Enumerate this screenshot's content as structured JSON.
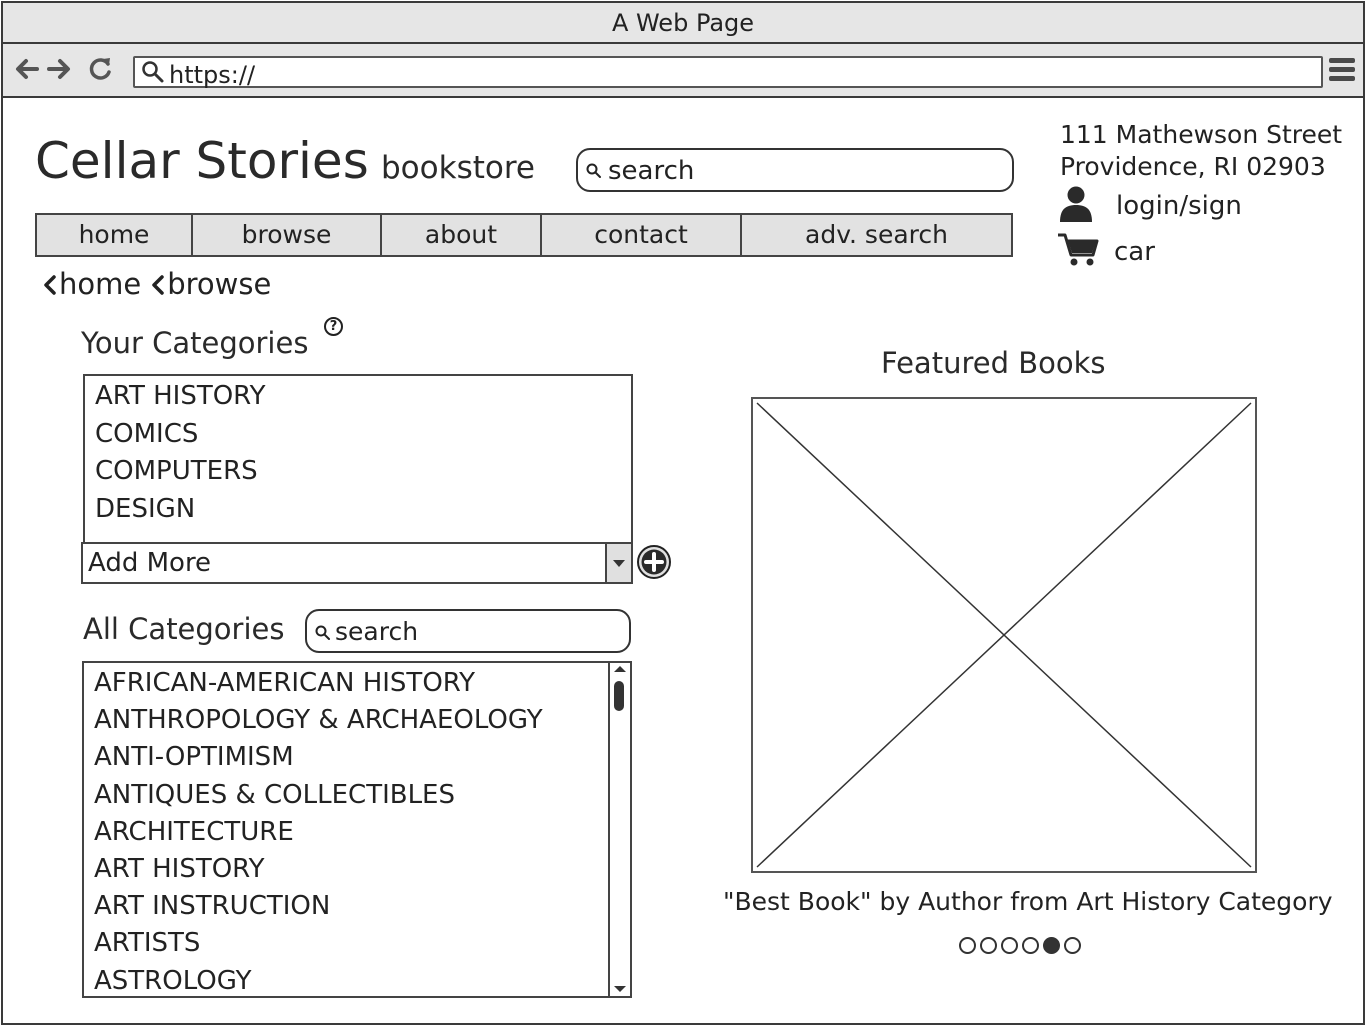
{
  "window": {
    "title": "A Web Page"
  },
  "browser": {
    "url": "https://",
    "back_icon": "arrow-left-icon",
    "forward_icon": "arrow-right-icon",
    "reload_icon": "reload-icon",
    "menu_icon": "hamburger-menu-icon"
  },
  "header": {
    "logo": "Cellar Stories",
    "logo_sub": "bookstore",
    "search_placeholder": "search",
    "address_line1": "111 Mathewson Street",
    "address_line2": "Providence, RI 02903",
    "login_label": "login/sign",
    "cart_label": "car"
  },
  "nav": {
    "tabs": [
      "home",
      "browse",
      "about",
      "contact",
      "adv. search"
    ]
  },
  "breadcrumb": [
    "home",
    "browse"
  ],
  "your_categories": {
    "title": "Your Categories",
    "help_glyph": "?",
    "items": [
      "ART HISTORY",
      "COMICS",
      "COMPUTERS",
      "DESIGN"
    ],
    "add_more_label": "Add More"
  },
  "all_categories": {
    "title": "All Categories",
    "search_placeholder": "search",
    "items": [
      "AFRICAN-AMERICAN HISTORY",
      "ANTHROPOLOGY & ARCHAEOLOGY",
      "ANTI-OPTIMISM",
      "ANTIQUES & COLLECTIBLES",
      "ARCHITECTURE",
      "ART HISTORY",
      "ART INSTRUCTION",
      "ARTISTS",
      "ASTROLOGY"
    ]
  },
  "featured": {
    "title": "Featured Books",
    "caption": "\"Best Book\" by Author from Art History Category",
    "carousel_count": 6,
    "carousel_active": 5
  }
}
